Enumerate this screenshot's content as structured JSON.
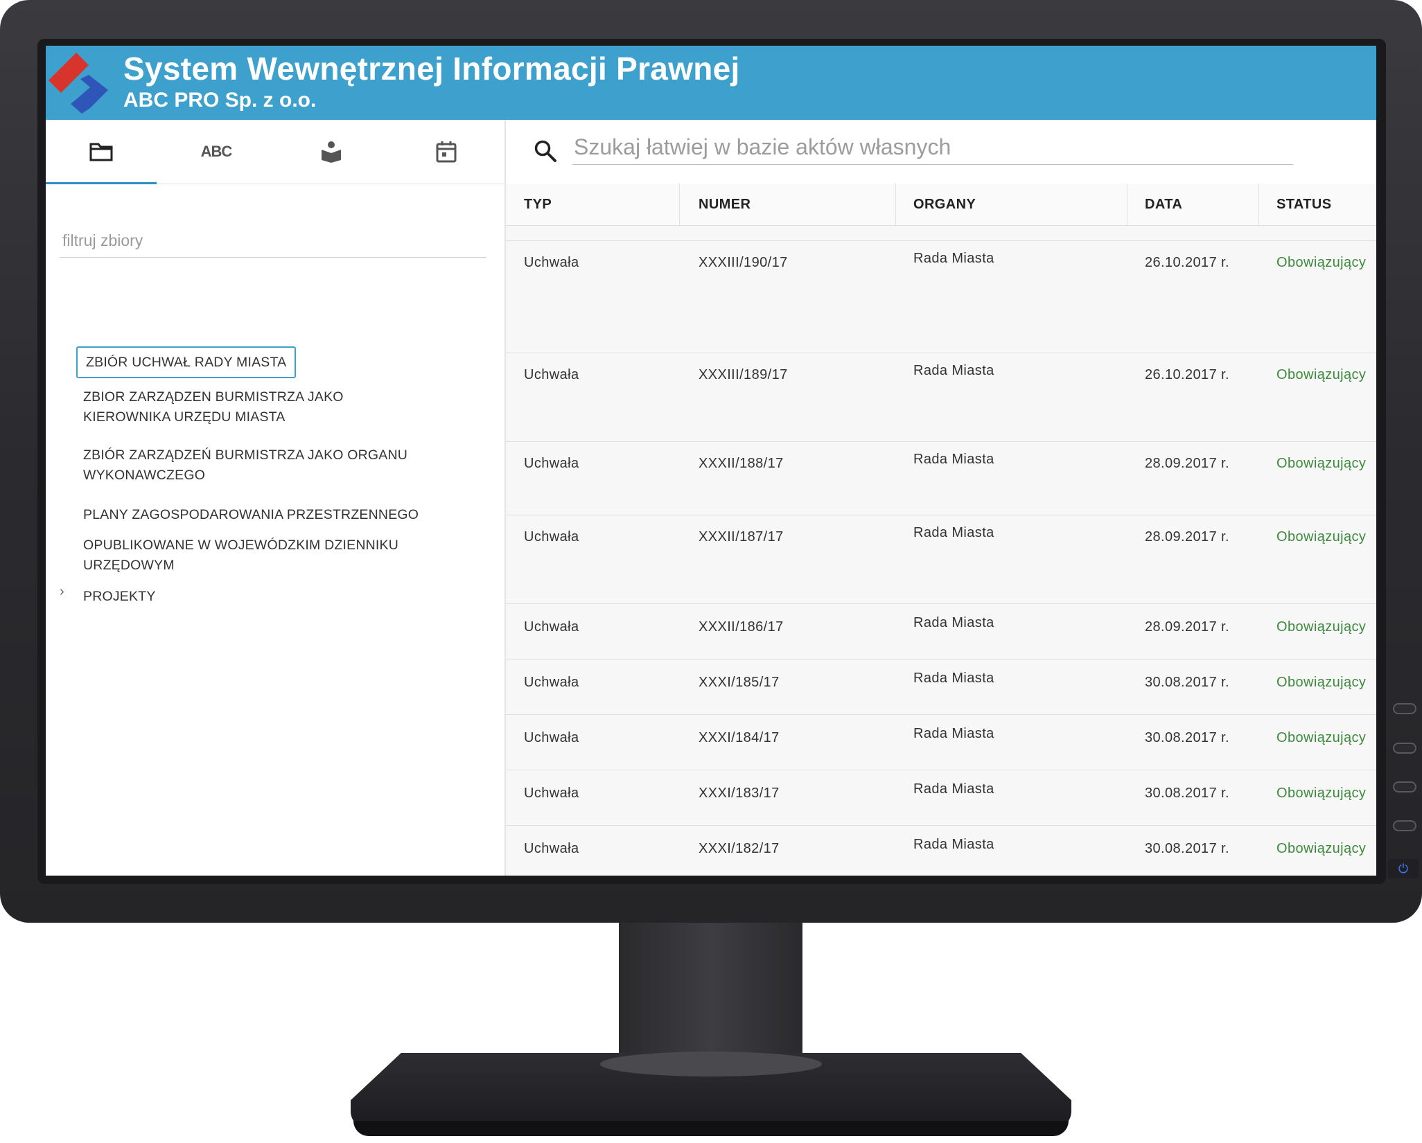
{
  "app": {
    "title": "System Wewnętrznej Informacji Prawnej",
    "subtitle": "ABC PRO Sp. z o.o."
  },
  "sidebar": {
    "tabs": [
      {
        "name": "folder",
        "label": ""
      },
      {
        "name": "abc",
        "label": "ABC"
      },
      {
        "name": "reader",
        "label": ""
      },
      {
        "name": "calendar",
        "label": ""
      }
    ],
    "filter_placeholder": "filtruj zbiory",
    "items": [
      {
        "label": "ZBIÓR UCHWAŁ RADY MIASTA",
        "selected": true
      },
      {
        "label": "ZBIOR ZARZĄDZEN BURMISTRZA JAKO KIEROWNIKA URZĘDU MIASTA"
      },
      {
        "label": "ZBIÓR ZARZĄDZEŃ BURMISTRZA JAKO ORGANU WYKONAWCZEGO"
      },
      {
        "label": "PLANY ZAGOSPODAROWANIA PRZESTRZENNEGO"
      },
      {
        "label": "OPUBLIKOWANE W WOJEWÓDZKIM DZIENNIKU URZĘDOWYM"
      },
      {
        "label": "PROJEKTY",
        "expandable": true
      }
    ]
  },
  "search": {
    "placeholder": "Szukaj łatwiej w bazie aktów własnych"
  },
  "table": {
    "columns": [
      "TYP",
      "NUMER",
      "ORGANY",
      "DATA",
      "STATUS"
    ],
    "rows": [
      {
        "typ": "Uchwała",
        "numer": "XXXIII/190/17",
        "organy": "Rada Miasta",
        "data": "26.10.2017 r.",
        "status": "Obowiązujący"
      },
      {
        "typ": "Uchwała",
        "numer": "XXXIII/189/17",
        "organy": "Rada Miasta",
        "data": "26.10.2017 r.",
        "status": "Obowiązujący"
      },
      {
        "typ": "Uchwała",
        "numer": "XXXII/188/17",
        "organy": "Rada Miasta",
        "data": "28.09.2017 r.",
        "status": "Obowiązujący"
      },
      {
        "typ": "Uchwała",
        "numer": "XXXII/187/17",
        "organy": "Rada Miasta",
        "data": "28.09.2017 r.",
        "status": "Obowiązujący"
      },
      {
        "typ": "Uchwała",
        "numer": "XXXII/186/17",
        "organy": "Rada Miasta",
        "data": "28.09.2017 r.",
        "status": "Obowiązujący"
      },
      {
        "typ": "Uchwała",
        "numer": "XXXI/185/17",
        "organy": "Rada Miasta",
        "data": "30.08.2017 r.",
        "status": "Obowiązujący"
      },
      {
        "typ": "Uchwała",
        "numer": "XXXI/184/17",
        "organy": "Rada Miasta",
        "data": "30.08.2017 r.",
        "status": "Obowiązujący"
      },
      {
        "typ": "Uchwała",
        "numer": "XXXI/183/17",
        "organy": "Rada Miasta",
        "data": "30.08.2017 r.",
        "status": "Obowiązujący"
      },
      {
        "typ": "Uchwała",
        "numer": "XXXI/182/17",
        "organy": "Rada Miasta",
        "data": "30.08.2017 r.",
        "status": "Obowiązujący"
      }
    ]
  },
  "colors": {
    "header": "#3ea0cc",
    "status": "#3d8a3d",
    "logo_red": "#d9342b",
    "logo_blue": "#2e56b8"
  }
}
